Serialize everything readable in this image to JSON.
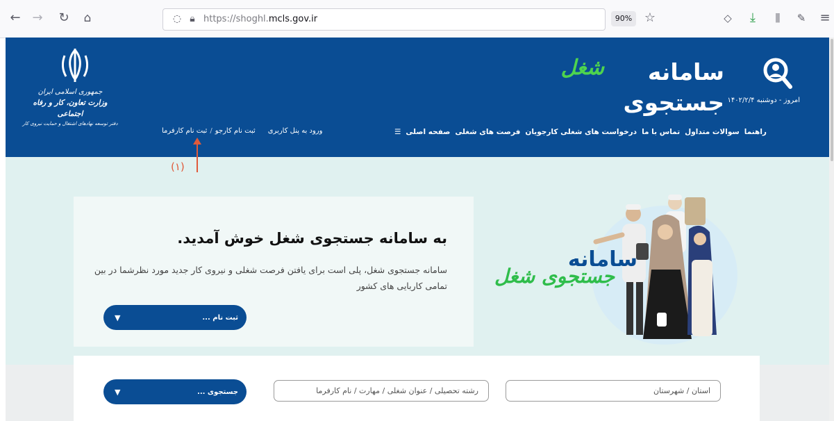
{
  "browser": {
    "url_prefix": "https://shoghl.",
    "url_host": "mcls.gov.ir",
    "zoom": "90%"
  },
  "site": {
    "title_main": "سامانه جستجوی",
    "title_accent": "شغل",
    "date": "امروز - دوشنبه ۱۴۰۲/۲/۴",
    "nav": [
      "صفحه اصلی",
      "فرصت های شغلی",
      "درخواست های شغلی کارجویان",
      "تماس با ما",
      "سوالات متداول",
      "راهنما"
    ],
    "nav_menu_icon": "☰",
    "login": {
      "employer_register": "ثبت نام کارفرما",
      "separator": "/",
      "jobseeker_register": "ثبت نام کارجو",
      "panel_login": "ورود به پنل کاربری"
    },
    "ministry": {
      "line1": "جمهوری اسلامی ایران",
      "line2": "وزارت تعاون، کار و رفاه اجتماعی",
      "line3": "دفتر توسعه نهادهای اشتغال و حمایت نیروی کار"
    }
  },
  "annotation": {
    "label": "(۱)",
    "color": "#e05a3a"
  },
  "welcome": {
    "title": "به سامانه جستجوی شغل خوش آمدید.",
    "description": "سامانه جستجوی شغل، پلی است برای یافتن فرصت شغلی و نیروی کار جدید مورد نظرشما در بین تمامی کاربایی های کشور",
    "register_button": "ثبت نام ..."
  },
  "hero": {
    "text_main": "سامانه",
    "text_accent": "جستجوی شغل"
  },
  "search": {
    "province_placeholder": "استان / شهرستان",
    "keyword_placeholder": "رشته تحصیلی / عنوان شغلی / مهارت / نام کارفرما",
    "search_button": "جستجوی ..."
  },
  "colors": {
    "header_blue": "#0a4d94",
    "accent_green": "#4ed44e",
    "page_bg": "#e0f1f0"
  }
}
